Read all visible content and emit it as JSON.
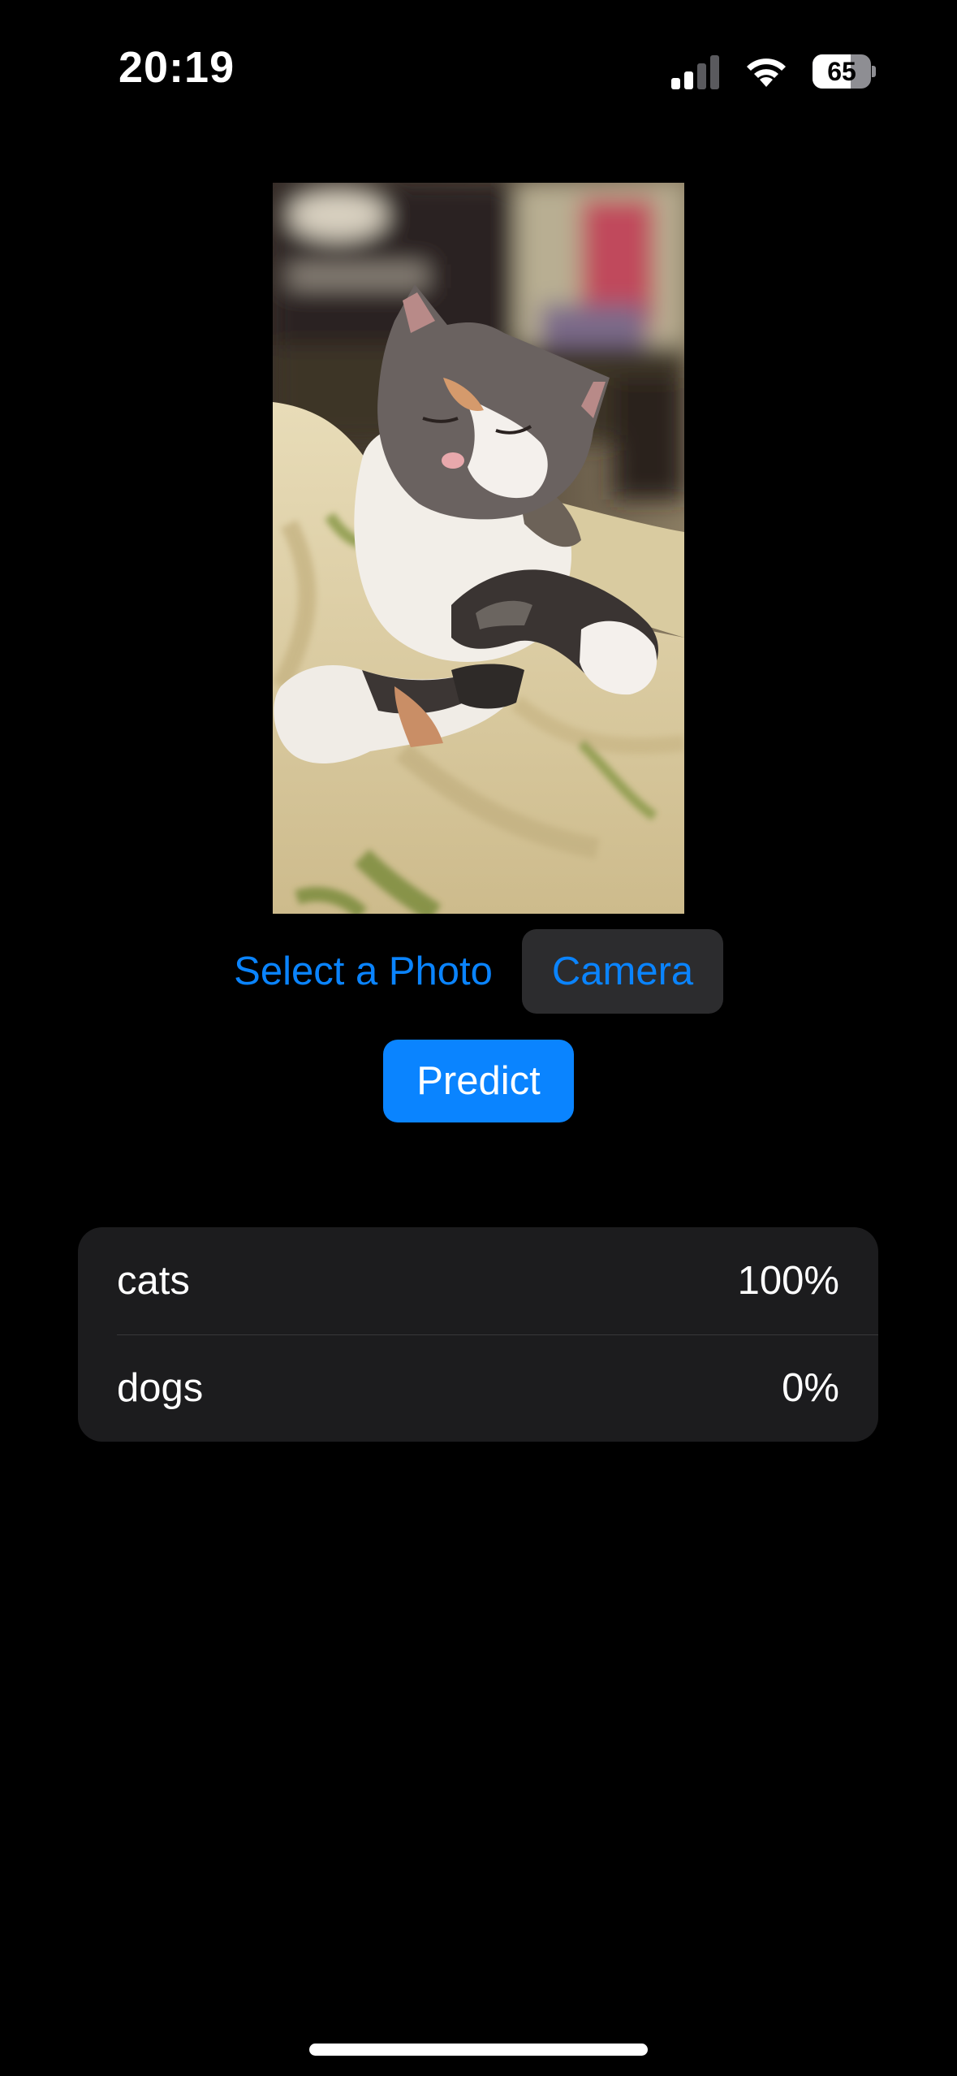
{
  "status_bar": {
    "time": "20:19",
    "battery_level": "65",
    "signal_bars_active": 2,
    "signal_bars_total": 4,
    "icons": [
      "cellular-signal-icon",
      "wifi-icon",
      "battery-icon"
    ]
  },
  "photo": {
    "subject": "calico-cat-photo"
  },
  "buttons": {
    "select_photo": "Select a Photo",
    "camera": "Camera",
    "predict": "Predict"
  },
  "results": [
    {
      "label": "cats",
      "value": "100%"
    },
    {
      "label": "dogs",
      "value": "0%"
    }
  ],
  "colors": {
    "accent": "#0a84ff",
    "background": "#000000",
    "card": "#1c1c1e",
    "secondary_button": "#2c2c2e"
  }
}
